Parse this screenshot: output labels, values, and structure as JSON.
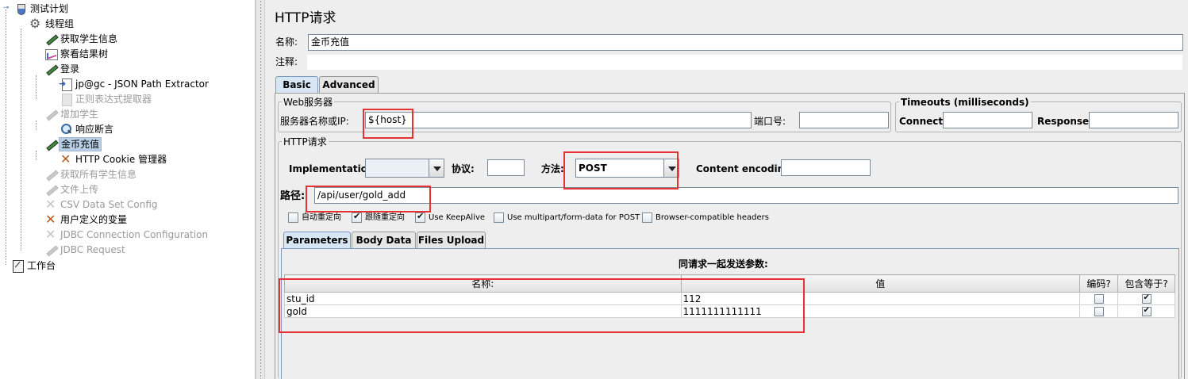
{
  "tree": {
    "items": [
      {
        "label": "测试计划",
        "icon": "test-plan-icon",
        "state": "normal"
      },
      {
        "label": "线程组",
        "icon": "thread-group-gear-icon",
        "state": "normal"
      },
      {
        "label": "获取学生信息",
        "icon": "sampler-pen-icon",
        "state": "normal"
      },
      {
        "label": "察看结果树",
        "icon": "result-tree-chart-icon",
        "state": "normal"
      },
      {
        "label": "登录",
        "icon": "sampler-pen-icon",
        "state": "normal"
      },
      {
        "label": "jp@gc - JSON Path Extractor",
        "icon": "extractor-doc-icon",
        "state": "normal"
      },
      {
        "label": "正则表达式提取器",
        "icon": "extractor-doc-icon",
        "state": "disabled"
      },
      {
        "label": "增加学生",
        "icon": "sampler-pen-icon",
        "state": "disabled"
      },
      {
        "label": "响应断言",
        "icon": "assertion-magnifier-icon",
        "state": "normal"
      },
      {
        "label": "金币充值",
        "icon": "sampler-pen-icon",
        "state": "selected"
      },
      {
        "label": "HTTP Cookie 管理器",
        "icon": "config-tools-icon",
        "state": "normal"
      },
      {
        "label": "获取所有学生信息",
        "icon": "sampler-pen-icon",
        "state": "disabled"
      },
      {
        "label": "文件上传",
        "icon": "sampler-pen-icon",
        "state": "disabled"
      },
      {
        "label": "CSV Data Set Config",
        "icon": "config-tools-icon",
        "state": "disabled"
      },
      {
        "label": "用户定义的变量",
        "icon": "config-tools-icon",
        "state": "normal"
      },
      {
        "label": "JDBC Connection Configuration",
        "icon": "config-tools-icon",
        "state": "disabled"
      },
      {
        "label": "JDBC Request",
        "icon": "sampler-pen-icon",
        "state": "disabled"
      },
      {
        "label": "工作台",
        "icon": "workbench-icon",
        "state": "normal"
      }
    ]
  },
  "panel": {
    "title": "HTTP请求",
    "name_label": "名称:",
    "name_value": "金币充值",
    "comment_label": "注释:",
    "comment_value": ""
  },
  "tabs": {
    "basic": "Basic",
    "advanced": "Advanced"
  },
  "web_server": {
    "group_title": "Web服务器",
    "server_label": "服务器名称或IP:",
    "server_value": "${host}",
    "port_label": "端口号:",
    "port_value": ""
  },
  "timeouts": {
    "group_title": "Timeouts (milliseconds)",
    "connect_label": "Connect:",
    "connect_value": "",
    "response_label": "Response:",
    "response_value": ""
  },
  "http_request": {
    "group_title": "HTTP请求",
    "implementation_label": "Implementation:",
    "implementation_value": "",
    "protocol_label": "协议:",
    "protocol_value": "",
    "method_label": "方法:",
    "method_value": "POST",
    "encoding_label": "Content encoding:",
    "encoding_value": "",
    "path_label": "路径:",
    "path_value": "/api/user/gold_add"
  },
  "options": [
    {
      "label": "自动重定向",
      "checked": false
    },
    {
      "label": "跟随重定向",
      "checked": true
    },
    {
      "label": "Use KeepAlive",
      "checked": true
    },
    {
      "label": "Use multipart/form-data for POST",
      "checked": false
    },
    {
      "label": "Browser-compatible headers",
      "checked": false
    }
  ],
  "param_tabs": {
    "parameters": "Parameters",
    "body_data": "Body Data",
    "files_upload": "Files Upload"
  },
  "params": {
    "caption": "同请求一起发送参数:",
    "columns": {
      "name": "名称:",
      "value": "值",
      "encode": "编码?",
      "include_equals": "包含等于?"
    },
    "rows": [
      {
        "name": "stu_id",
        "value": "112",
        "encode": false,
        "include_equals": true
      },
      {
        "name": "gold",
        "value": "1111111111111",
        "encode": false,
        "include_equals": true
      }
    ]
  },
  "colors": {
    "highlight_box": "#e53333",
    "selected_tab": "#d6e6f5",
    "selected_tree_item": "#b8cfe5"
  }
}
